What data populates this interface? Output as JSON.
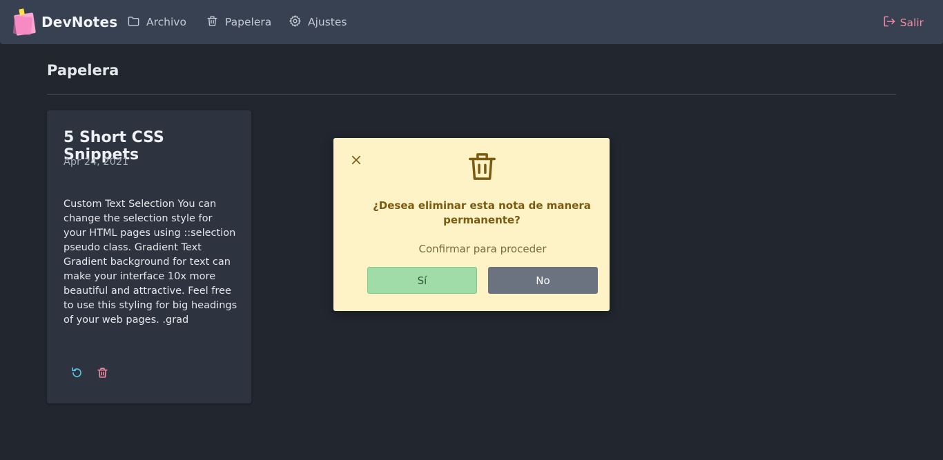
{
  "app": {
    "name": "DevNotes"
  },
  "nav": {
    "items": [
      {
        "label": "Archivo",
        "icon": "folder-icon"
      },
      {
        "label": "Papelera",
        "icon": "trash-icon"
      },
      {
        "label": "Ajustes",
        "icon": "gear-icon"
      }
    ],
    "logout_label": "Salir"
  },
  "page": {
    "title": "Papelera"
  },
  "notes": [
    {
      "title": "5 Short CSS Snippets",
      "date": "Apr 24, 2021",
      "body": "Custom Text Selection You can change the selection style for your HTML pages using ::selection pseudo class. Gradient Text Gradient background for text can make your interface 10x more beautiful and attractive. Feel free to use this styling for big headings of your web pages. .grad"
    }
  ],
  "modal": {
    "title": "¿Desea eliminar esta nota de manera permanente?",
    "subtitle": "Confirmar para proceder",
    "confirm_label": "Sí",
    "cancel_label": "No"
  },
  "colors": {
    "background": "#21262f",
    "navbar": "#374151",
    "card": "#2d333f",
    "modal": "#fef3c7",
    "accent_danger": "#f08aa2",
    "accent_restore": "#5cc8e8",
    "confirm": "#a0dca8",
    "cancel": "#6b7280"
  }
}
